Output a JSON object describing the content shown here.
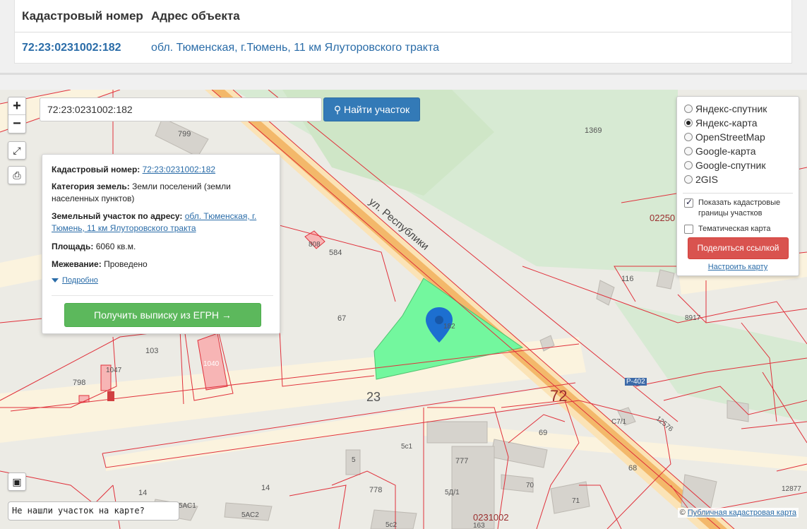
{
  "table": {
    "headers": [
      "Кадастровый номер",
      "Адрес объекта"
    ],
    "row": {
      "number": "72:23:0231002:182",
      "address": "обл. Тюменская, г.Тюмень, 11 км Ялуторовского тракта"
    }
  },
  "map": {
    "zoom_in": "+",
    "zoom_out": "−",
    "search_value": "72:23:0231002:182",
    "search_button": "Найти участок",
    "labels": {
      "street": "ул. Республики",
      "district_23": "23",
      "region_72": "72",
      "highway": "Р-402",
      "block_0225": "02250",
      "block_0231002": "0231002",
      "p799": "799",
      "p1369": "1369",
      "p584": "584",
      "p808": "808",
      "p67": "67",
      "p103": "103",
      "p798": "798",
      "p1047": "1047",
      "p1040": "1040",
      "p116": "116",
      "p8917": "8917",
      "p69": "69",
      "p68": "68",
      "pC71": "С7/1",
      "p12576": "12576",
      "p5c1": "5с1",
      "p5": "5",
      "p777": "777",
      "p5D1": "5Д/1",
      "p70": "70",
      "p71": "71",
      "p778": "778",
      "p14a": "14",
      "p14b": "14",
      "p5AC1": "5АС1",
      "p5AC2": "5АС2",
      "p5c2": "5с2",
      "p12877": "12877",
      "p163": "163",
      "pin_label": "182"
    },
    "info": {
      "cadastral_label": "Кадастровый номер:",
      "cadastral_value": "72:23:0231002:182",
      "category_label": "Категория земель:",
      "category_value": "Земли поселений (земли населенных пунктов)",
      "address_label": "Земельный участок по адресу:",
      "address_value": "обл. Тюменская, г. Тюмень, 11 км Ялуторовского тракта",
      "area_label": "Площадь:",
      "area_value": "6060 кв.м.",
      "survey_label": "Межевание:",
      "survey_value": "Проведено",
      "more": "Подробно",
      "egrn_button": "Получить выписку из ЕГРН →"
    },
    "layers": {
      "options": [
        "Яндекс-спутник",
        "Яндекс-карта",
        "OpenStreetMap",
        "Google-карта",
        "Google-спутник",
        "2GIS"
      ],
      "selected": "Яндекс-карта",
      "show_borders": "Показать кадастровые границы участков",
      "show_borders_checked": true,
      "thematic": "Тематическая карта",
      "thematic_checked": false,
      "share_button": "Поделиться ссылкой",
      "setup_link": "Настроить карту"
    },
    "not_found": "Не нашли участок на карте?",
    "attribution_symbol": "©",
    "attribution_link": "Публичная кадастровая карта",
    "colors": {
      "parcel_fill": "#73f79e",
      "boundary": "#e0313b",
      "road": "#fbe3b6",
      "main_road": "#f3b86a",
      "button_blue": "#337ab7",
      "button_green": "#5cb85c",
      "button_red": "#d9534f"
    }
  }
}
